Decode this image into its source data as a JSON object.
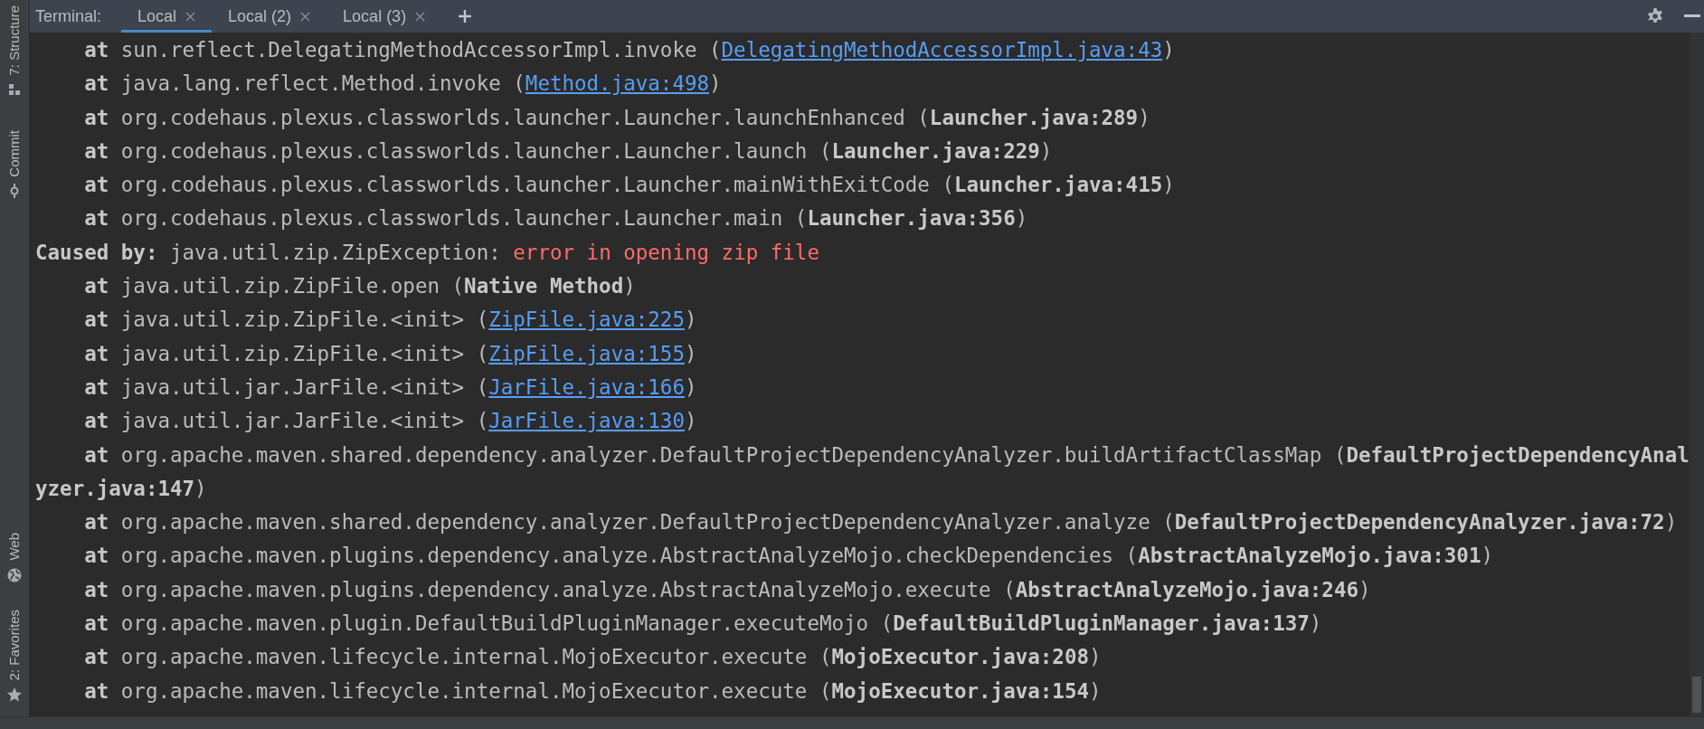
{
  "sidebar": {
    "items": [
      {
        "label": "7: Structure",
        "kind": "structure"
      },
      {
        "label": "Commit",
        "kind": "commit"
      },
      {
        "label": "Web",
        "kind": "web"
      },
      {
        "label": "2: Favorites",
        "kind": "favorites"
      }
    ]
  },
  "terminal": {
    "title": "Terminal:",
    "tabs": [
      {
        "label": "Local",
        "selected": true
      },
      {
        "label": "Local (2)",
        "selected": false
      },
      {
        "label": "Local (3)",
        "selected": false
      }
    ],
    "lines": [
      {
        "kind": "linked",
        "at": "at",
        "method": "sun.reflect.DelegatingMethodAccessorImpl.invoke (",
        "source": "DelegatingMethodAccessorImpl.java:43",
        "close": ")"
      },
      {
        "kind": "linked",
        "at": "at",
        "method": "java.lang.reflect.Method.invoke (",
        "source": "Method.java:498",
        "close": ")"
      },
      {
        "kind": "frame",
        "at": "at",
        "method": "org.codehaus.plexus.classworlds.launcher.Launcher.launchEnhanced (",
        "source": "Launcher.java:289",
        "close": ")"
      },
      {
        "kind": "frame",
        "at": "at",
        "method": "org.codehaus.plexus.classworlds.launcher.Launcher.launch (",
        "source": "Launcher.java:229",
        "close": ")"
      },
      {
        "kind": "frame",
        "at": "at",
        "method": "org.codehaus.plexus.classworlds.launcher.Launcher.mainWithExitCode (",
        "source": "Launcher.java:415",
        "close": ")"
      },
      {
        "kind": "frame",
        "at": "at",
        "method": "org.codehaus.plexus.classworlds.launcher.Launcher.main (",
        "source": "Launcher.java:356",
        "close": ")"
      },
      {
        "kind": "cause",
        "label": "Caused by:",
        "exception": "java.util.zip.ZipException:",
        "message": "error in opening zip file"
      },
      {
        "kind": "frame",
        "at": "at",
        "method": "java.util.zip.ZipFile.open (",
        "source": "Native Method",
        "close": ")"
      },
      {
        "kind": "linked",
        "at": "at",
        "method": "java.util.zip.ZipFile.<init> (",
        "source": "ZipFile.java:225",
        "close": ")"
      },
      {
        "kind": "linked",
        "at": "at",
        "method": "java.util.zip.ZipFile.<init> (",
        "source": "ZipFile.java:155",
        "close": ")"
      },
      {
        "kind": "linked",
        "at": "at",
        "method": "java.util.jar.JarFile.<init> (",
        "source": "JarFile.java:166",
        "close": ")"
      },
      {
        "kind": "linked",
        "at": "at",
        "method": "java.util.jar.JarFile.<init> (",
        "source": "JarFile.java:130",
        "close": ")"
      },
      {
        "kind": "frame",
        "at": "at",
        "method": "org.apache.maven.shared.dependency.analyzer.DefaultProjectDependencyAnalyzer.buildArtifactClassMap (",
        "source": "DefaultProjectDependencyAnalyzer.java:147",
        "close": ")"
      },
      {
        "kind": "frame",
        "at": "at",
        "method": "org.apache.maven.shared.dependency.analyzer.DefaultProjectDependencyAnalyzer.analyze (",
        "source": "DefaultProjectDependencyAnalyzer.java:72",
        "close": ")"
      },
      {
        "kind": "frame",
        "at": "at",
        "method": "org.apache.maven.plugins.dependency.analyze.AbstractAnalyzeMojo.checkDependencies (",
        "source": "AbstractAnalyzeMojo.java:301",
        "close": ")"
      },
      {
        "kind": "frame",
        "at": "at",
        "method": "org.apache.maven.plugins.dependency.analyze.AbstractAnalyzeMojo.execute (",
        "source": "AbstractAnalyzeMojo.java:246",
        "close": ")"
      },
      {
        "kind": "frame",
        "at": "at",
        "method": "org.apache.maven.plugin.DefaultBuildPluginManager.executeMojo (",
        "source": "DefaultBuildPluginManager.java:137",
        "close": ")"
      },
      {
        "kind": "frame",
        "at": "at",
        "method": "org.apache.maven.lifecycle.internal.MojoExecutor.execute (",
        "source": "MojoExecutor.java:208",
        "close": ")"
      },
      {
        "kind": "frame",
        "at": "at",
        "method": "org.apache.maven.lifecycle.internal.MojoExecutor.execute (",
        "source": "MojoExecutor.java:154",
        "close": ")"
      }
    ]
  }
}
